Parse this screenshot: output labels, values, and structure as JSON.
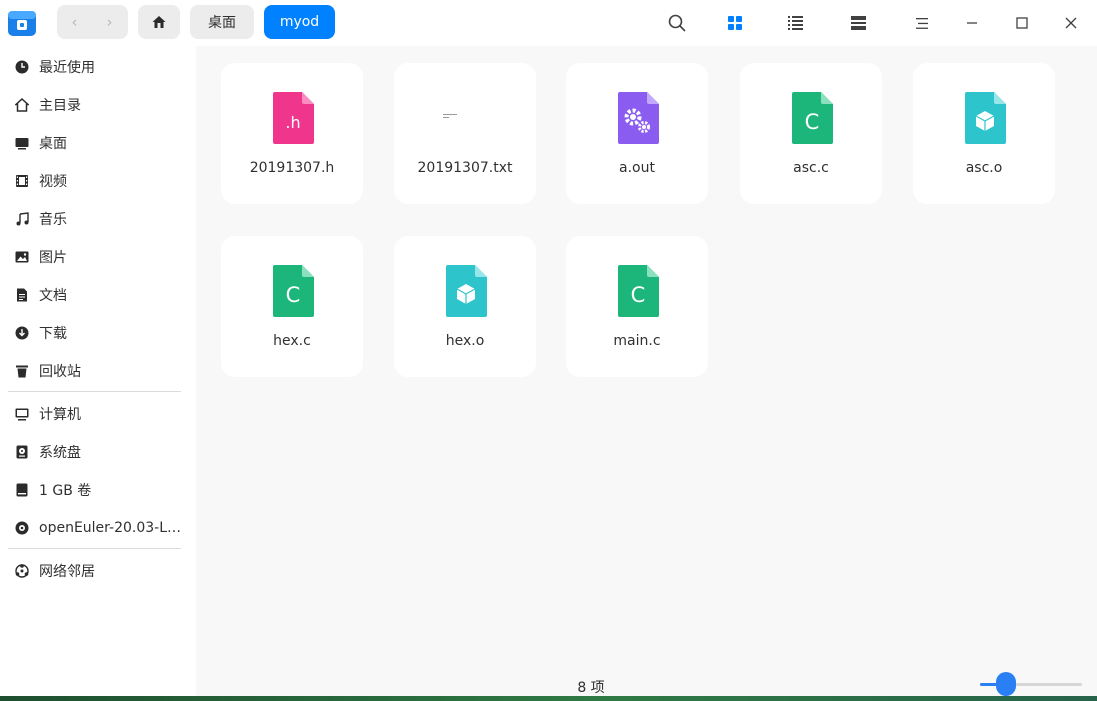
{
  "toolbar": {
    "back_label": "‹",
    "forward_label": "›",
    "breadcrumbs": [
      "桌面",
      "myod"
    ]
  },
  "sidebar": {
    "items": [
      {
        "label": "最近使用",
        "icon": "clock-icon"
      },
      {
        "label": "主目录",
        "icon": "home-icon"
      },
      {
        "label": "桌面",
        "icon": "desktop-icon"
      },
      {
        "label": "视频",
        "icon": "video-icon"
      },
      {
        "label": "音乐",
        "icon": "music-icon"
      },
      {
        "label": "图片",
        "icon": "image-icon"
      },
      {
        "label": "文档",
        "icon": "document-icon"
      },
      {
        "label": "下载",
        "icon": "download-icon"
      },
      {
        "label": "回收站",
        "icon": "trash-icon"
      }
    ],
    "devices": [
      {
        "label": "计算机",
        "icon": "computer-icon"
      },
      {
        "label": "系统盘",
        "icon": "system-disk-icon"
      },
      {
        "label": "1 GB 卷",
        "icon": "drive-icon"
      },
      {
        "label": "openEuler-20.03-L…",
        "icon": "optical-disc-icon"
      }
    ],
    "network": [
      {
        "label": "网络邻居",
        "icon": "network-icon"
      }
    ]
  },
  "files": [
    {
      "name": "20191307.h",
      "type": "header",
      "icon_text": ".h",
      "color": "#f0368c"
    },
    {
      "name": "20191307.txt",
      "type": "text",
      "icon_text": "",
      "color": "#ffffff"
    },
    {
      "name": "a.out",
      "type": "executable",
      "icon_text": "",
      "color": "#8a5cf0"
    },
    {
      "name": "asc.c",
      "type": "c-source",
      "icon_text": "C",
      "color": "#1db67a"
    },
    {
      "name": "asc.o",
      "type": "object",
      "icon_text": "",
      "color": "#2ec4cc"
    },
    {
      "name": "hex.c",
      "type": "c-source",
      "icon_text": "C",
      "color": "#1db67a"
    },
    {
      "name": "hex.o",
      "type": "object",
      "icon_text": "",
      "color": "#2ec4cc"
    },
    {
      "name": "main.c",
      "type": "c-source",
      "icon_text": "C",
      "color": "#1db67a"
    }
  ],
  "status": {
    "item_count": "8 项",
    "zoom_level": 0.25
  },
  "colors": {
    "accent": "#0081ff",
    "sidebar_bg": "#ffffff",
    "content_bg": "#f8f8f8"
  }
}
